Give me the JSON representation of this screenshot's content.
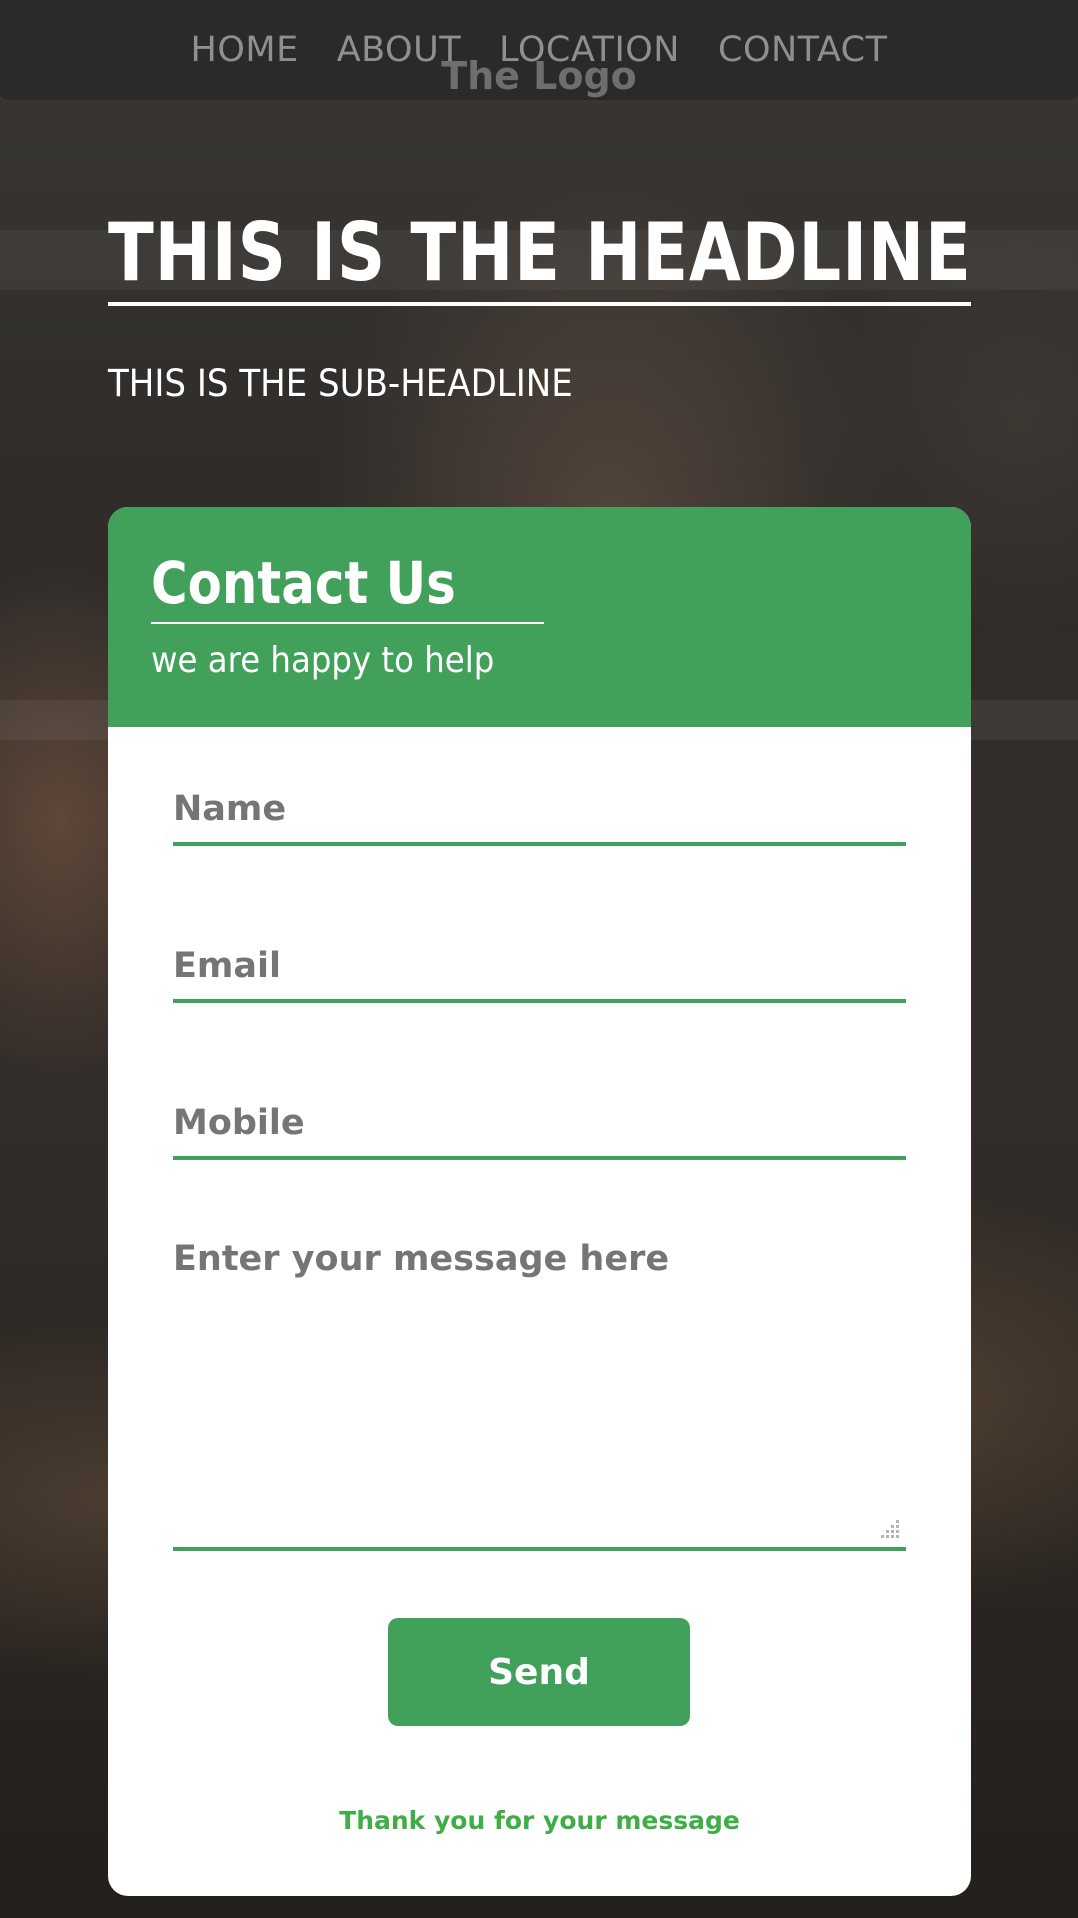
{
  "nav": {
    "links": [
      "HOME",
      "ABOUT",
      "LOCATION",
      "CONTACT"
    ],
    "logo": "The Logo"
  },
  "hero": {
    "headline": "THIS IS THE HEADLINE",
    "subheadline": "THIS IS THE SUB-HEADLINE"
  },
  "contact": {
    "title": "Contact Us",
    "subtitle": "we are happy to help",
    "fields": {
      "name": {
        "value": "",
        "placeholder": "Name"
      },
      "email": {
        "value": "",
        "placeholder": "Email"
      },
      "mobile": {
        "value": "",
        "placeholder": "Mobile"
      },
      "message": {
        "value": "",
        "placeholder": "Enter your message here"
      }
    },
    "send_label": "Send",
    "thank_you": "Thank you for your message"
  },
  "colors": {
    "accent": "#41a05a",
    "success_text": "#3fae47",
    "nav_background": "#2b2a28",
    "nav_text": "#8f8f8f"
  }
}
